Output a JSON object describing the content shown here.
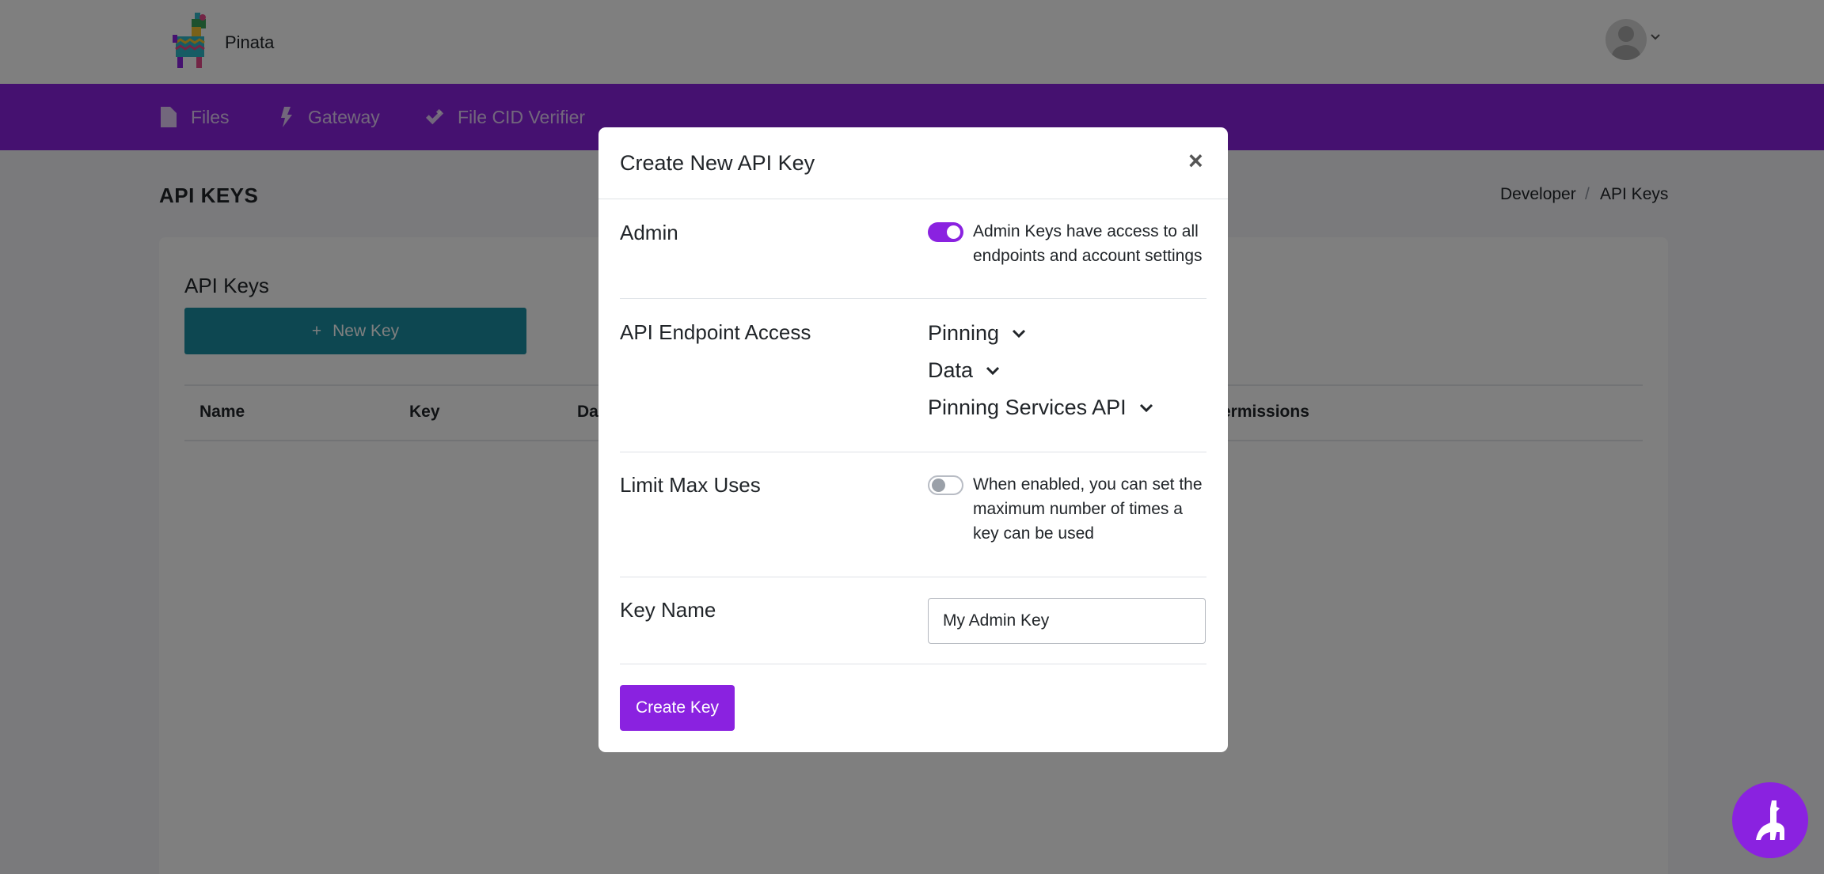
{
  "header": {
    "brand": "Pinata",
    "logo_icon": "pinata-llama-icon",
    "avatar_icon": "user-avatar-icon"
  },
  "nav": {
    "items": [
      {
        "label": "Files",
        "icon": "file-icon"
      },
      {
        "label": "Gateway",
        "icon": "lightning-icon"
      },
      {
        "label": "File CID Verifier",
        "icon": "double-check-icon"
      }
    ]
  },
  "page": {
    "title": "API KEYS",
    "breadcrumb": [
      "Developer",
      "/",
      "API Keys"
    ],
    "card_title": "API Keys",
    "new_key_icon": "+",
    "new_key_label": "New Key",
    "table_headers": [
      "Name",
      "Key",
      "Da",
      "ermissions"
    ]
  },
  "modal": {
    "title": "Create New API Key",
    "close": "×",
    "admin": {
      "label": "Admin",
      "enabled": true,
      "description": "Admin Keys have access to all endpoints and account settings"
    },
    "endpoint_access": {
      "label": "API Endpoint Access",
      "items": [
        "Pinning",
        "Data",
        "Pinning Services API"
      ]
    },
    "limit": {
      "label": "Limit Max Uses",
      "enabled": false,
      "description": "When enabled, you can set the maximum number of times a key can be used"
    },
    "key_name": {
      "label": "Key Name",
      "value": "My Admin Key"
    },
    "submit_label": "Create Key"
  },
  "colors": {
    "accent": "#8a22e0",
    "teal": "#1a8fa3",
    "overlay": "rgba(0,0,0,0.5)"
  },
  "chat_icon": "llama-chat-icon"
}
